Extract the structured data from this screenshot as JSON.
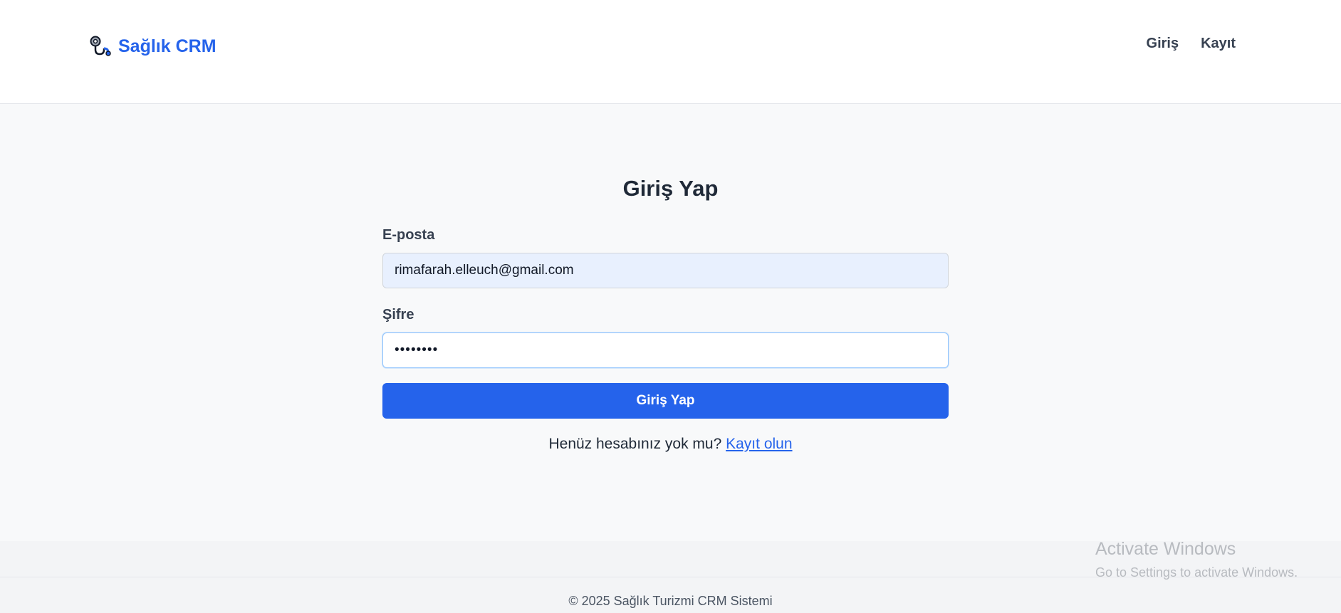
{
  "header": {
    "brand_icon": "stethoscope-icon",
    "brand_name": "Sağlık CRM",
    "brand_color": "#2563eb",
    "nav": [
      {
        "label": "Giriş"
      },
      {
        "label": "Kayıt"
      }
    ]
  },
  "login_form": {
    "title": "Giriş Yap",
    "email_label": "E-posta",
    "email_value": "rimafarah.elleuch@gmail.com",
    "password_label": "Şifre",
    "password_value": "••••••••",
    "submit_label": "Giriş Yap",
    "submit_color": "#2563eb",
    "signup_prompt": "Henüz hesabınız yok mu?",
    "signup_link": "Kayıt olun"
  },
  "footer": {
    "copyright": "© 2025 Sağlık Turizmi CRM Sistemi"
  },
  "watermark": {
    "title": "Activate Windows",
    "subtitle": "Go to Settings to activate Windows."
  }
}
